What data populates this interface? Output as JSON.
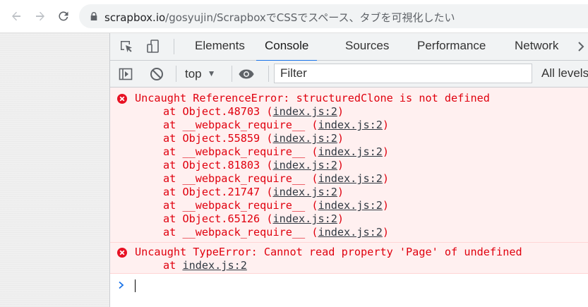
{
  "browser": {
    "url_host": "scrapbox.io",
    "url_path": "/gosyujin/ScrapboxでCSSでスペース、タブを可視化したい"
  },
  "devtools": {
    "tabs": [
      {
        "label": "Elements",
        "active": false
      },
      {
        "label": "Console",
        "active": true
      },
      {
        "label": "Sources",
        "active": false
      },
      {
        "label": "Performance",
        "active": false
      },
      {
        "label": "Network",
        "active": false
      }
    ],
    "console_toolbar": {
      "context": "top",
      "filter_placeholder": "Filter",
      "levels_label": "All levels"
    },
    "messages": [
      {
        "type": "error",
        "text": "Uncaught ReferenceError: structuredClone is not defined",
        "trace": [
          {
            "prefix": "at ",
            "fn": "Object.48703",
            "loc": "index.js:2"
          },
          {
            "prefix": "at ",
            "fn": "__webpack_require__",
            "loc": "index.js:2"
          },
          {
            "prefix": "at ",
            "fn": "Object.55859",
            "loc": "index.js:2"
          },
          {
            "prefix": "at ",
            "fn": "__webpack_require__",
            "loc": "index.js:2"
          },
          {
            "prefix": "at ",
            "fn": "Object.81803",
            "loc": "index.js:2"
          },
          {
            "prefix": "at ",
            "fn": "__webpack_require__",
            "loc": "index.js:2"
          },
          {
            "prefix": "at ",
            "fn": "Object.21747",
            "loc": "index.js:2"
          },
          {
            "prefix": "at ",
            "fn": "__webpack_require__",
            "loc": "index.js:2"
          },
          {
            "prefix": "at ",
            "fn": "Object.65126",
            "loc": "index.js:2"
          },
          {
            "prefix": "at ",
            "fn": "__webpack_require__",
            "loc": "index.js:2"
          }
        ]
      },
      {
        "type": "error",
        "text": "Uncaught TypeError: Cannot read property 'Page' of undefined",
        "trace": [
          {
            "prefix": "at ",
            "fn": "",
            "loc": "index.js:2"
          }
        ]
      }
    ]
  },
  "colors": {
    "error_text": "#e0000e",
    "error_bg": "#fff0f0",
    "active_tab_underline": "#1a73e8",
    "prompt_chevron": "#1a73e8"
  },
  "icons": {
    "back": "arrow-left-icon",
    "forward": "arrow-right-icon",
    "reload": "reload-icon",
    "lock": "lock-icon",
    "inspect": "inspect-element-icon",
    "device": "device-toggle-icon",
    "sidebar": "show-sidebar-icon",
    "clear": "clear-console-icon",
    "eye": "live-expression-eye-icon",
    "error": "error-circle-icon",
    "prompt": "prompt-chevron-icon"
  }
}
